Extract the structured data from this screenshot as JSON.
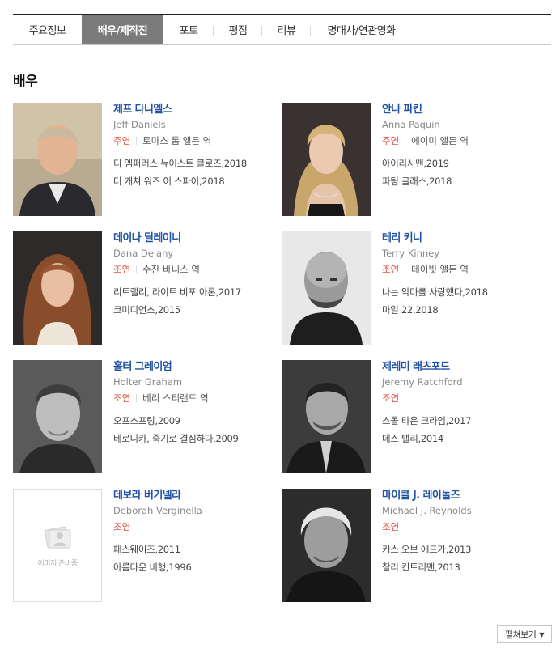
{
  "tabs": [
    {
      "label": "주요정보",
      "active": false
    },
    {
      "label": "배우/제작진",
      "active": true
    },
    {
      "label": "포토",
      "active": false
    },
    {
      "label": "평점",
      "active": false
    },
    {
      "label": "리뷰",
      "active": false
    },
    {
      "label": "명대사/연관영화",
      "active": false
    }
  ],
  "section_title": "배우",
  "actors": [
    {
      "name": "제프 다니엘스",
      "english_name": "Jeff Daniels",
      "role_type": "주연",
      "role": "토마스 톰 앨든 역",
      "films": [
        "디 엠퍼러스 뉴이스트 클로즈,2018",
        "더 캐쳐 워즈 어 스파이,2018"
      ]
    },
    {
      "name": "안나 파킨",
      "english_name": "Anna Paquin",
      "role_type": "주연",
      "role": "에이미 앨든 역",
      "films": [
        "아이리시맨,2019",
        "파팅 글래스,2018"
      ]
    },
    {
      "name": "데이나 딜레이니",
      "english_name": "Dana Delany",
      "role_type": "조연",
      "role": "수잔 바니스 역",
      "films": [
        "리트랠리, 라이트 비포 아론,2017",
        "코미디언스,2015"
      ]
    },
    {
      "name": "테리 키니",
      "english_name": "Terry Kinney",
      "role_type": "조연",
      "role": "데이빗 앨든 역",
      "films": [
        "나는 악마를 사랑했다,2018",
        "마일 22,2018"
      ]
    },
    {
      "name": "홀터 그레이엄",
      "english_name": "Holter Graham",
      "role_type": "조연",
      "role": "베리 스티랜드 역",
      "films": [
        "오프스프링,2009",
        "베로니카, 죽기로 결심하다,2009"
      ]
    },
    {
      "name": "제레미 래츠포드",
      "english_name": "Jeremy Ratchford",
      "role_type": "조연",
      "role": "",
      "films": [
        "스몰 타운 크라임,2017",
        "데스 밸리,2014"
      ]
    },
    {
      "name": "데보라 버기넬라",
      "english_name": "Deborah Verginella",
      "role_type": "조연",
      "role": "",
      "films": [
        "패스웨이즈,2011",
        "아름다운 비행,1996"
      ],
      "photo_placeholder": "이미지 준비중"
    },
    {
      "name": "마이클 J. 레이놀즈",
      "english_name": "Michael J. Reynolds",
      "role_type": "조연",
      "role": "",
      "films": [
        "커스 오브 에드가,2013",
        "찰리 컨트리맨,2013"
      ]
    }
  ],
  "more_button": {
    "label": "펼쳐보기",
    "icon": "caret-down-icon"
  },
  "colors": {
    "accent_tab_bg": "#7b7b7b",
    "name_link": "#2152a5",
    "role_type": "#e64f3d"
  }
}
